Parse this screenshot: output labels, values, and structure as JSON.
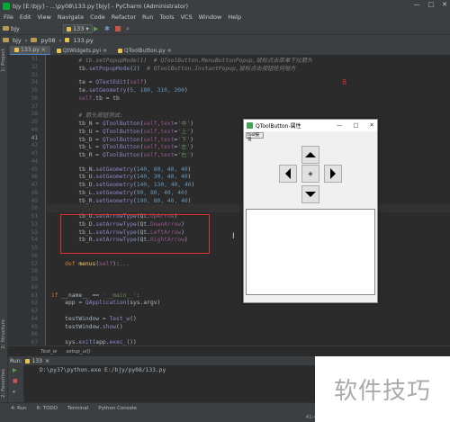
{
  "window": {
    "title": "bjy [E:\\bjy] - ...\\py08\\133.py [bjy] - PyCharm (Administrator)",
    "controls": [
      "—",
      "□",
      "✕"
    ]
  },
  "menu": [
    "File",
    "Edit",
    "View",
    "Navigate",
    "Code",
    "Refactor",
    "Run",
    "Tools",
    "VCS",
    "Window",
    "Help"
  ],
  "toolbar": {
    "project": "bjy",
    "run_config": "133",
    "icons": [
      "run-icon",
      "debug-icon",
      "stop-icon",
      "search-icon"
    ]
  },
  "navbar": {
    "crumbs": [
      "bjy",
      "py08",
      "133.py"
    ]
  },
  "tabs": [
    {
      "label": "133.py",
      "active": true
    },
    {
      "label": "QtWidgets.pyi",
      "active": false
    },
    {
      "label": "QToolButton.py",
      "active": false
    }
  ],
  "side_tools": {
    "project": "1: Project",
    "structure": "2: Structure",
    "favorites": "2: Favorites"
  },
  "editor": {
    "line_numbers": [
      "31",
      "32",
      "33",
      "34",
      "35",
      "36",
      "37",
      "38",
      "39",
      "40",
      "41",
      "42",
      "43",
      "44",
      "45",
      "46",
      "47",
      "48",
      "49",
      "50",
      "51",
      "52",
      "53",
      "54",
      "55",
      "56",
      "57",
      "58",
      "59",
      "60",
      "61",
      "62",
      "63",
      "64",
      "65",
      "66",
      "67"
    ],
    "current_line": "41",
    "lines": [
      [
        {
          "t": "        # tb.setPopupMode(1)  ",
          "c": "c"
        },
        {
          "t": "# QToolButton.MenuButtonPopup,鼠标点击菜单下拉箭头",
          "c": "c"
        }
      ],
      [
        {
          "t": "        tb.",
          "c": ""
        },
        {
          "t": "setPopupMode",
          "c": "fn"
        },
        {
          "t": "(",
          "c": ""
        },
        {
          "t": "2",
          "c": "n"
        },
        {
          "t": ")  ",
          "c": ""
        },
        {
          "t": "# QToolButton.InstantPopup,鼠标点击按钮任何地方",
          "c": "c"
        }
      ],
      [],
      [
        {
          "t": "        te = ",
          "c": ""
        },
        {
          "t": "QTextEdit",
          "c": "fn"
        },
        {
          "t": "(",
          "c": ""
        },
        {
          "t": "self",
          "c": "p"
        },
        {
          "t": ")",
          "c": ""
        }
      ],
      [
        {
          "t": "        te.",
          "c": ""
        },
        {
          "t": "setGeometry",
          "c": "fn"
        },
        {
          "t": "(",
          "c": ""
        },
        {
          "t": "5, 180, 310, 200",
          "c": "n"
        },
        {
          "t": ")",
          "c": ""
        }
      ],
      [
        {
          "t": "        ",
          "c": ""
        },
        {
          "t": "self",
          "c": "p"
        },
        {
          "t": ".tb = tb",
          "c": ""
        }
      ],
      [],
      [
        {
          "t": "        # 箭头按钮测试:",
          "c": "c"
        }
      ],
      [
        {
          "t": "        tb_N = ",
          "c": ""
        },
        {
          "t": "QToolButton",
          "c": "fn"
        },
        {
          "t": "(",
          "c": ""
        },
        {
          "t": "self",
          "c": "p"
        },
        {
          "t": ",",
          "c": "k"
        },
        {
          "t": "text",
          "c": "p"
        },
        {
          "t": "=",
          "c": ""
        },
        {
          "t": "'中'",
          "c": "s"
        },
        {
          "t": ")",
          "c": ""
        }
      ],
      [
        {
          "t": "        tb_U = ",
          "c": ""
        },
        {
          "t": "QToolButton",
          "c": "fn"
        },
        {
          "t": "(",
          "c": ""
        },
        {
          "t": "self",
          "c": "p"
        },
        {
          "t": ",",
          "c": "k"
        },
        {
          "t": "text",
          "c": "p"
        },
        {
          "t": "=",
          "c": ""
        },
        {
          "t": "'上'",
          "c": "s"
        },
        {
          "t": ")",
          "c": ""
        }
      ],
      [
        {
          "t": "        tb_D = ",
          "c": ""
        },
        {
          "t": "QToolButton",
          "c": "fn"
        },
        {
          "t": "(",
          "c": ""
        },
        {
          "t": "self",
          "c": "p"
        },
        {
          "t": ",",
          "c": "k"
        },
        {
          "t": "text",
          "c": "p"
        },
        {
          "t": "=",
          "c": ""
        },
        {
          "t": "'下'",
          "c": "s"
        },
        {
          "t": ")",
          "c": ""
        }
      ],
      [
        {
          "t": "        tb_L = ",
          "c": ""
        },
        {
          "t": "QToolButton",
          "c": "fn"
        },
        {
          "t": "(",
          "c": ""
        },
        {
          "t": "self",
          "c": "p"
        },
        {
          "t": ",",
          "c": "k"
        },
        {
          "t": "text",
          "c": "p"
        },
        {
          "t": "=",
          "c": ""
        },
        {
          "t": "'左'",
          "c": "s"
        },
        {
          "t": ")",
          "c": ""
        }
      ],
      [
        {
          "t": "        tb_R = ",
          "c": ""
        },
        {
          "t": "QToolButton",
          "c": "fn"
        },
        {
          "t": "(",
          "c": ""
        },
        {
          "t": "self",
          "c": "p"
        },
        {
          "t": ",",
          "c": "k"
        },
        {
          "t": "text",
          "c": "p"
        },
        {
          "t": "=",
          "c": ""
        },
        {
          "t": "'右'",
          "c": "s"
        },
        {
          "t": ")",
          "c": ""
        }
      ],
      [],
      [
        {
          "t": "        tb_N.",
          "c": ""
        },
        {
          "t": "setGeometry",
          "c": "fn"
        },
        {
          "t": "(",
          "c": ""
        },
        {
          "t": "140, 80, 40, 40",
          "c": "n"
        },
        {
          "t": ")",
          "c": ""
        }
      ],
      [
        {
          "t": "        tb_U.",
          "c": ""
        },
        {
          "t": "setGeometry",
          "c": "fn"
        },
        {
          "t": "(",
          "c": ""
        },
        {
          "t": "140, 30, 40, 40",
          "c": "n"
        },
        {
          "t": ")",
          "c": ""
        }
      ],
      [
        {
          "t": "        tb_D.",
          "c": ""
        },
        {
          "t": "setGeometry",
          "c": "fn"
        },
        {
          "t": "(",
          "c": ""
        },
        {
          "t": "140, 130, 40, 40",
          "c": "n"
        },
        {
          "t": ")",
          "c": ""
        }
      ],
      [
        {
          "t": "        tb_L.",
          "c": ""
        },
        {
          "t": "setGeometry",
          "c": "fn"
        },
        {
          "t": "(",
          "c": ""
        },
        {
          "t": "90, 80, 40, 40",
          "c": "n"
        },
        {
          "t": ")",
          "c": ""
        }
      ],
      [
        {
          "t": "        tb_R.",
          "c": ""
        },
        {
          "t": "setGeometry",
          "c": "fn"
        },
        {
          "t": "(",
          "c": ""
        },
        {
          "t": "190, 80, 40, 40",
          "c": "n"
        },
        {
          "t": ")",
          "c": ""
        }
      ],
      [],
      [
        {
          "t": "        tb_U.",
          "c": ""
        },
        {
          "t": "setArrowType",
          "c": "fn"
        },
        {
          "t": "(Qt.",
          "c": ""
        },
        {
          "t": "UpArrow",
          "c": "p"
        },
        {
          "t": ")",
          "c": ""
        }
      ],
      [
        {
          "t": "        tb_D.",
          "c": ""
        },
        {
          "t": "setArrowType",
          "c": "fn"
        },
        {
          "t": "(Qt.",
          "c": ""
        },
        {
          "t": "DownArrow",
          "c": "p"
        },
        {
          "t": ")",
          "c": ""
        }
      ],
      [
        {
          "t": "        tb_L.",
          "c": ""
        },
        {
          "t": "setArrowType",
          "c": "fn"
        },
        {
          "t": "(Qt.",
          "c": ""
        },
        {
          "t": "LeftArrow",
          "c": "p"
        },
        {
          "t": ")",
          "c": ""
        }
      ],
      [
        {
          "t": "        tb_R.",
          "c": ""
        },
        {
          "t": "setArrowType",
          "c": "fn"
        },
        {
          "t": "(Qt.",
          "c": ""
        },
        {
          "t": "RightArrow",
          "c": "p"
        },
        {
          "t": ")",
          "c": ""
        }
      ],
      [],
      [],
      [
        {
          "t": "    ",
          "c": ""
        },
        {
          "t": "def ",
          "c": "k"
        },
        {
          "t": "menus",
          "c": "f"
        },
        {
          "t": "(",
          "c": ""
        },
        {
          "t": "self",
          "c": "p"
        },
        {
          "t": "):",
          "c": ""
        },
        {
          "t": "...",
          "c": "c"
        }
      ],
      [],
      [],
      [],
      [
        {
          "t": "if ",
          "c": "k"
        },
        {
          "t": "__name__ == ",
          "c": ""
        },
        {
          "t": "'__main__'",
          "c": "s"
        },
        {
          "t": ":",
          "c": ""
        }
      ],
      [
        {
          "t": "    app = ",
          "c": ""
        },
        {
          "t": "QApplication",
          "c": "fn"
        },
        {
          "t": "(sys.argv)",
          "c": ""
        }
      ],
      [],
      [
        {
          "t": "    testWindow = ",
          "c": ""
        },
        {
          "t": "Test_w",
          "c": "fn"
        },
        {
          "t": "()",
          "c": ""
        }
      ],
      [
        {
          "t": "    testWindow.",
          "c": ""
        },
        {
          "t": "show",
          "c": "fn"
        },
        {
          "t": "()",
          "c": ""
        }
      ],
      [],
      [
        {
          "t": "    sys.",
          "c": ""
        },
        {
          "t": "exit",
          "c": "fn"
        },
        {
          "t": "(app.",
          "c": ""
        },
        {
          "t": "exec_",
          "c": "fn"
        },
        {
          "t": "())",
          "c": ""
        }
      ]
    ],
    "marker": "8"
  },
  "editor_breadcrumb": [
    "Test_w",
    "setup_ui()"
  ],
  "run_panel": {
    "title": "Run:",
    "config": "133",
    "output": "D:\\py37\\python.exe E:/bjy/py08/133.py"
  },
  "bottom_tabs": [
    "4: Run",
    "6: TODO",
    "Terminal",
    "Python Console"
  ],
  "status": {
    "position": "41:4"
  },
  "watermark": "软件技巧",
  "qt_window": {
    "title": "QToolButton-属性",
    "menu_button": "tool按钮",
    "controls": [
      "—",
      "□",
      "✕"
    ],
    "center_glyph": "◈"
  }
}
